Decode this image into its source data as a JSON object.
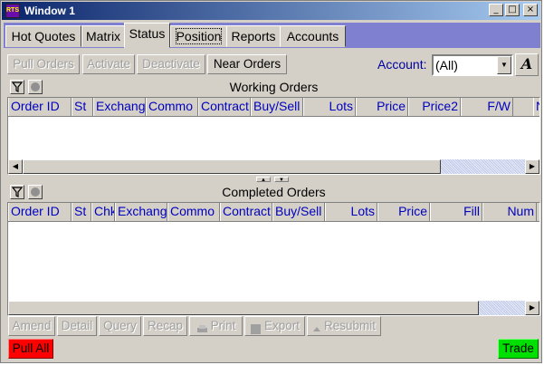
{
  "window": {
    "title": "Window 1",
    "app_icon": "RTS",
    "minimize": "_",
    "maximize": "□",
    "close": "×"
  },
  "tabs": [
    {
      "label": "Hot Quotes"
    },
    {
      "label": "Matrix"
    },
    {
      "label": "Status",
      "active": true
    },
    {
      "label": "Position"
    },
    {
      "label": "Reports"
    },
    {
      "label": "Accounts"
    }
  ],
  "toolbar": {
    "pull_orders": "Pull Orders",
    "activate": "Activate",
    "deactivate": "Deactivate",
    "near_orders": "Near Orders",
    "account_label": "Account:",
    "account_value": "(All)",
    "font_button": "A"
  },
  "working_orders": {
    "title": "Working Orders",
    "columns": [
      "Order ID",
      "St",
      "Exchang",
      "Commo",
      "Contract",
      "Buy/Sell",
      "Lots",
      "Price",
      "Price2",
      "F/W",
      "N"
    ]
  },
  "completed_orders": {
    "title": "Completed Orders",
    "columns": [
      "Order ID",
      "St",
      "Chk",
      "Exchang",
      "Commo",
      "Contract",
      "Buy/Sell",
      "Lots",
      "Price",
      "Fill",
      "Num"
    ]
  },
  "bottom": {
    "amend": "Amend",
    "detail": "Detail",
    "query": "Query",
    "recap": "Recap",
    "print": "Print",
    "export": "Export",
    "resubmit": "Resubmit",
    "pull_all": "Pull All",
    "trade": "Trade"
  },
  "colors": {
    "pull_all": "#ff0000",
    "trade": "#00e000",
    "title_bar": "#0a246a",
    "header_text": "#0000c0"
  }
}
